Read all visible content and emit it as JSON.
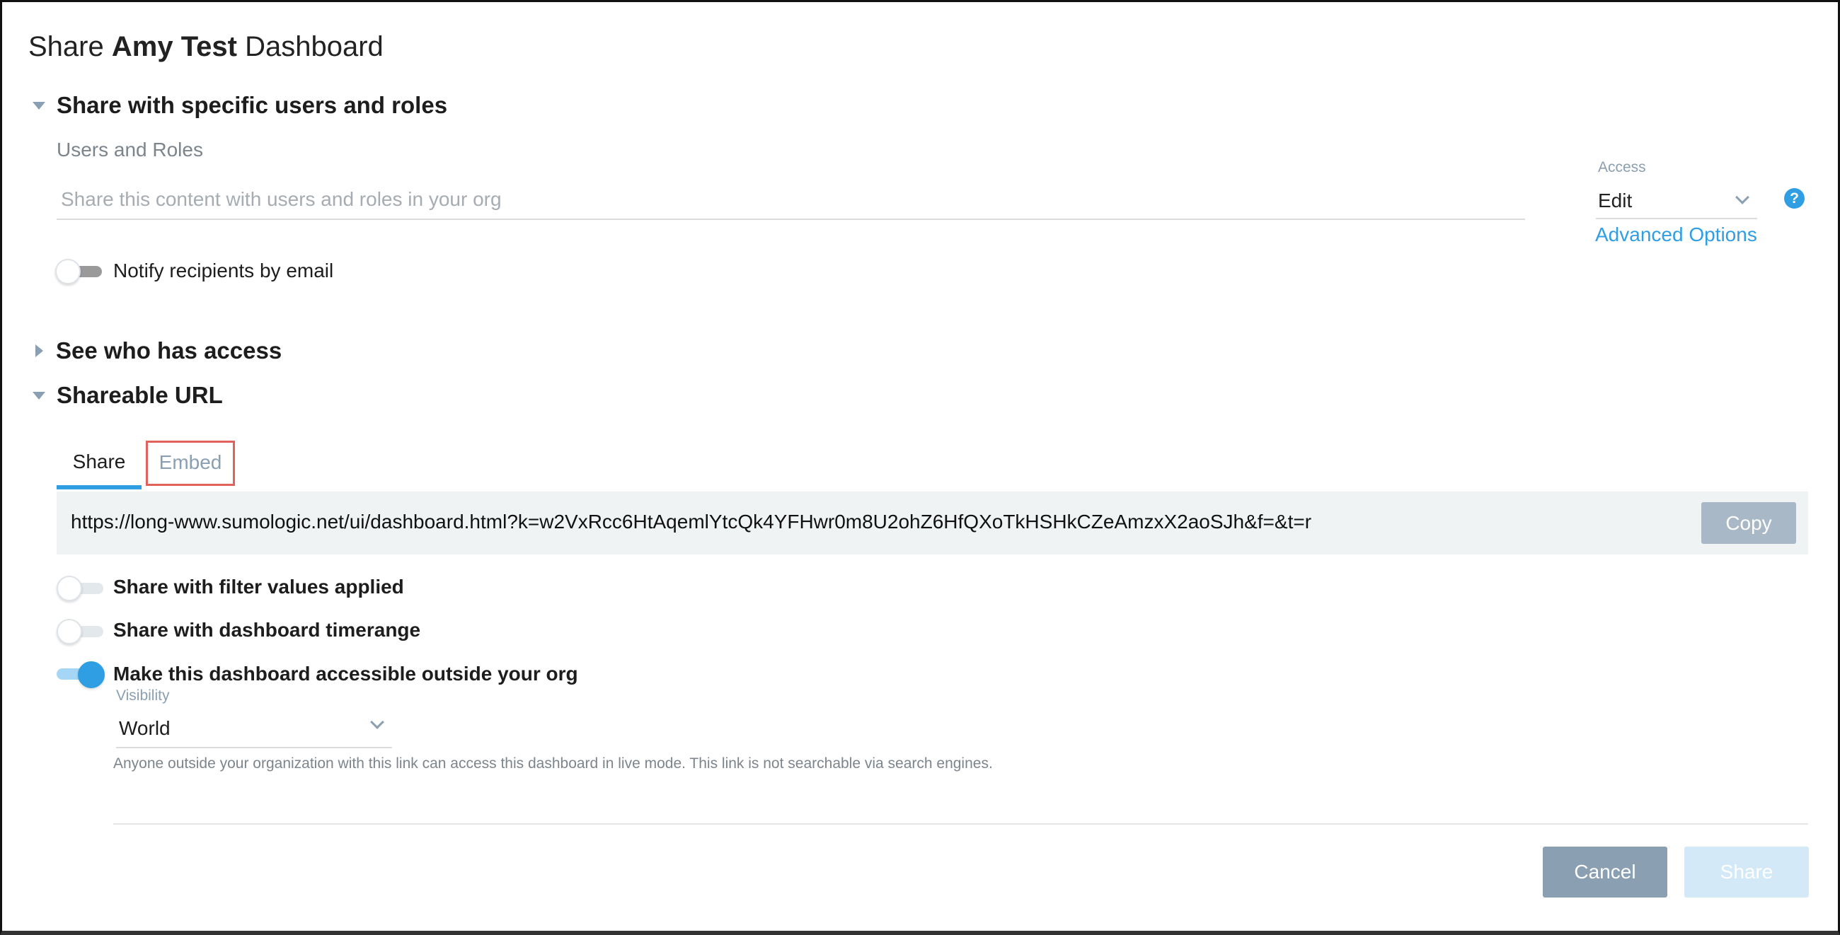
{
  "dialog": {
    "title_prefix": "Share",
    "title_name": "Amy Test",
    "title_suffix": "Dashboard"
  },
  "specific_users": {
    "header": "Share with specific users and roles",
    "expanded": true,
    "users_label": "Users and Roles",
    "users_placeholder": "Share this content with users and roles in your org",
    "access_label": "Access",
    "access_value": "Edit",
    "advanced_options": "Advanced Options",
    "help_icon": "question-circle-icon",
    "notify_label": "Notify recipients by email",
    "notify_on": false
  },
  "who_has_access": {
    "header": "See who has access",
    "expanded": false
  },
  "shareable_url": {
    "header": "Shareable URL",
    "expanded": true,
    "tabs": [
      {
        "label": "Share",
        "active": true
      },
      {
        "label": "Embed",
        "active": false,
        "highlighted": true
      }
    ],
    "url": "https://long-www.sumologic.net/ui/dashboard.html?k=w2VxRcc6HtAqemlYtcQk4YFHwr0m8U2ohZ6HfQXoTkHSHkCZeAmzxX2aoSJh&f=&t=r",
    "copy_label": "Copy",
    "options": [
      {
        "label": "Share with filter values applied",
        "on": false
      },
      {
        "label": "Share with dashboard timerange",
        "on": false
      },
      {
        "label": "Make this dashboard accessible outside your org",
        "on": true
      }
    ],
    "visibility_label": "Visibility",
    "visibility_value": "World",
    "visibility_help": "Anyone outside your organization with this link can access this dashboard in live mode. This link is not searchable via search engines."
  },
  "footer": {
    "cancel_label": "Cancel",
    "share_label": "Share"
  },
  "colors": {
    "accent": "#2f9ee3",
    "highlight_border": "#e0625a",
    "url_bg": "#eff3f4",
    "cancel_bg": "#8a9fb2",
    "share_disabled_bg": "#d3e9f8"
  }
}
